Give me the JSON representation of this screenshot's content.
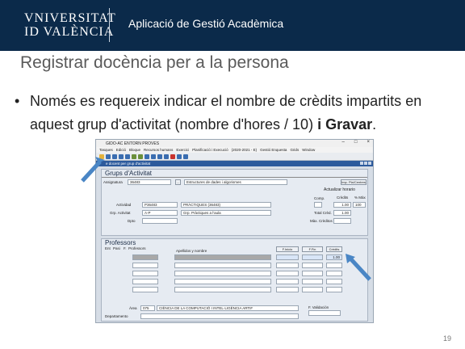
{
  "header": {
    "logo_line1": "VNIVERSITAT",
    "logo_line2": "ID VALÈNCIA",
    "app_title": "Aplicació de Gestió Acadèmica"
  },
  "slide": {
    "title": "Registrar docència per a la persona",
    "bullet_part1": "Només es requereix indicar el nombre de crèdits impartits en aquest grup d'activitat (nombre d'hores / 10) ",
    "bullet_bold": "i Gravar",
    "bullet_end": ".",
    "page_number": "19"
  },
  "app": {
    "window_title": "GIDO-AC ENTORN PROVES",
    "menu": [
      "Tasques",
      "Edició",
      "Bloque",
      "Recursos humans",
      "Exercici",
      "Planificació i Execució",
      "(2020-2021 - E)",
      "Gestió Enquesta",
      "Grids",
      "Window"
    ],
    "window_subtitle": "e docent per grup d'activitat",
    "grups": {
      "title": "Grups d'Activitat",
      "assignatura_label": "Assignatura",
      "assignatura_code": "36483",
      "assignatura_name": "Estructures de dades i algorismes",
      "btn_imp": "Imp. Pla/Centres",
      "btn_actualizar": "Actualizar horario",
      "comp_label": "Comp.",
      "creditos_label": "Crèdits",
      "pct_max_label": "% Màx",
      "actividad_label": "Actividad",
      "actividad_code": "P36483",
      "actividad_name": "PRÀCTIQUES (36483)",
      "grupo_label": "Grp. Activitat",
      "grupo_code": "A-P",
      "grupo_name": "Grp. Pràctiques a l'aula",
      "dpto_label": "Dpto",
      "total_label": "Total Crèd.",
      "total_value": "1.00",
      "credits_value": "1.00",
      "pct_value": "100",
      "max_label": "Màx. Crèditos"
    },
    "professors": {
      "title": "Professors",
      "col_ent": "Ent",
      "col_pasi": "Pasi",
      "col_f": "F.",
      "col_professors": "Professors",
      "col_apellidos": "Apellidos y nombre",
      "btn_finicio": "F.Inicio",
      "btn_ffin": "F.Fin",
      "btn_creditos": "Crèdits",
      "row1_credits": "1.00",
      "area_label": "Àrea",
      "area_code": "075",
      "area_name": "CIÈNCIA DE LA COMPUTACIÓ I INTEL·LIGÈNCIA ARTIF",
      "fvalidacion_label": "F. Validación",
      "departamento_label": "Departamento"
    }
  },
  "colors": {
    "header_bg": "#0b2a4a",
    "arrow": "#4a86c5"
  }
}
